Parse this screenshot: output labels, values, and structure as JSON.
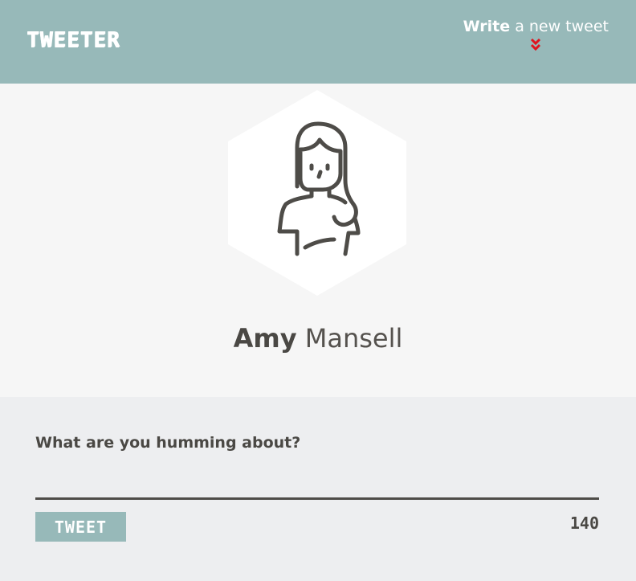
{
  "header": {
    "logo": "TWEETER",
    "compose_toggle": {
      "strong": "Write",
      "light": "a new tweet",
      "icon": "double-chevron-down-icon",
      "icon_color": "#e0141e"
    },
    "background": "#97b9b9"
  },
  "profile": {
    "avatar_icon": "woman-avatar-icon",
    "first_name": "Amy",
    "last_name": "Mansell"
  },
  "compose": {
    "prompt": "What are you humming about?",
    "input_value": "",
    "input_placeholder": "",
    "button_label": "TWEET",
    "char_count": "140"
  }
}
